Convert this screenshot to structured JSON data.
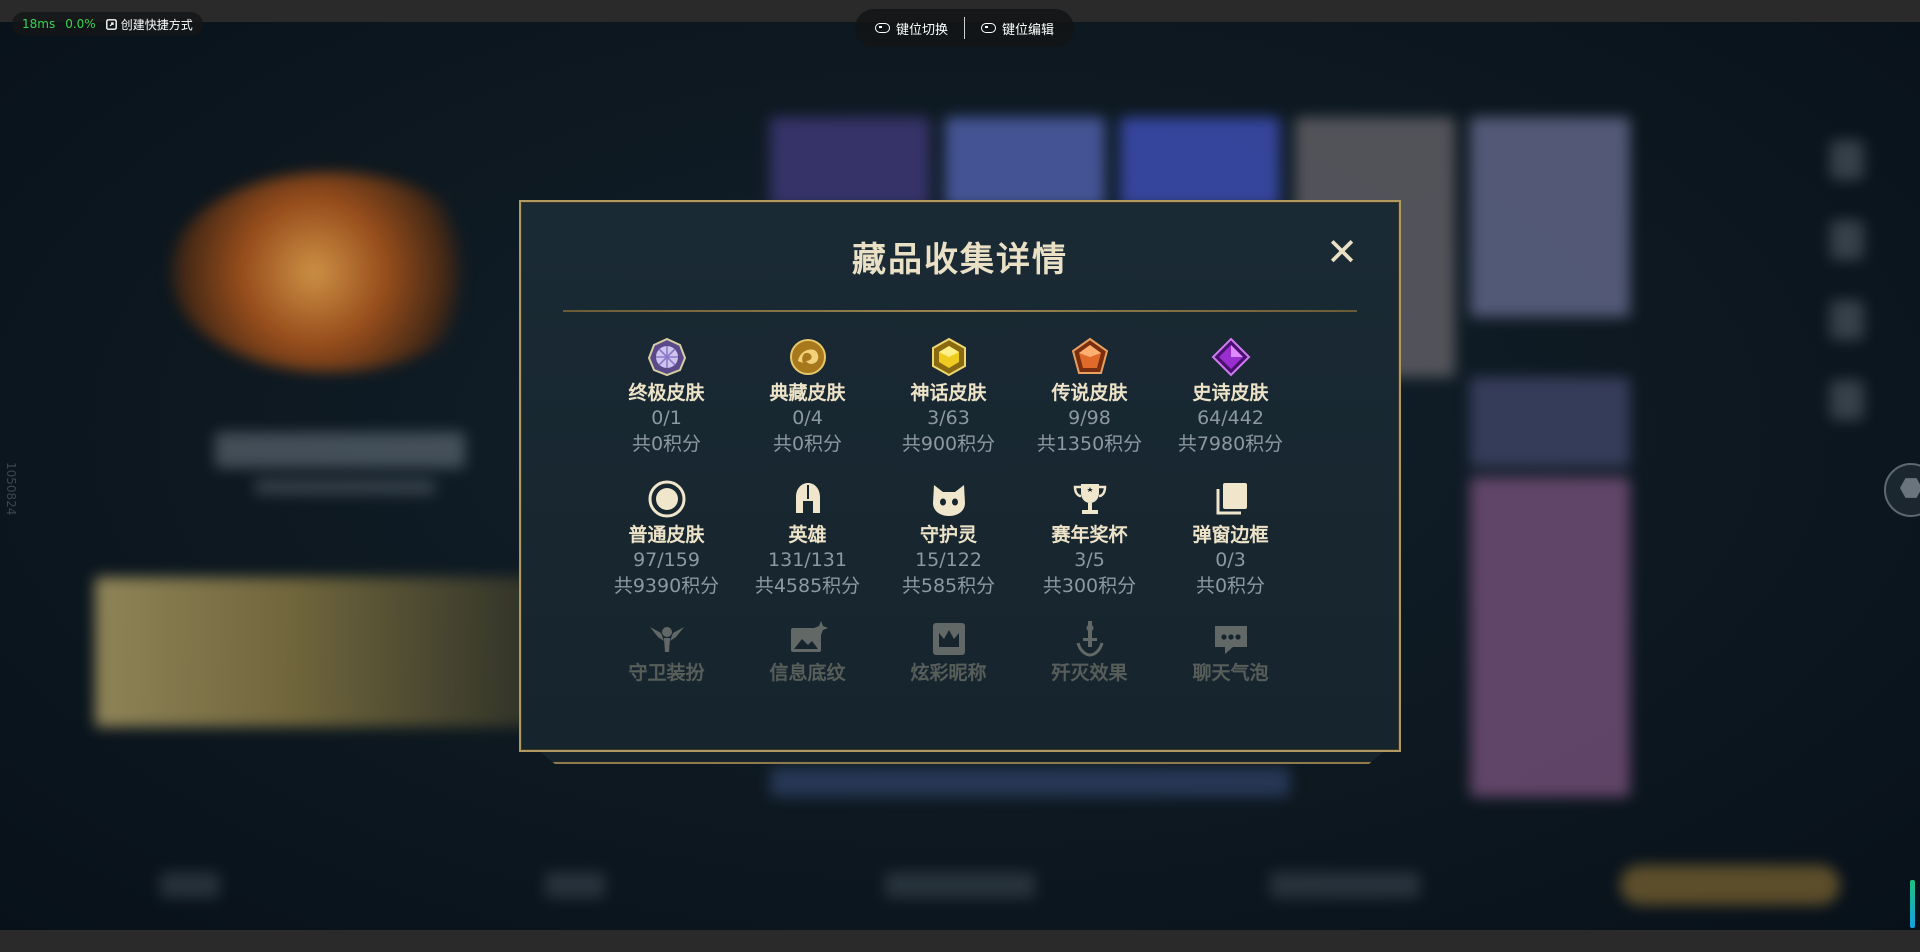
{
  "hud": {
    "latency": "18ms",
    "loss": "0.0%",
    "create_shortcut": "创建快捷方式"
  },
  "keymap": {
    "switch_label": "键位切换",
    "edit_label": "键位编辑"
  },
  "background": {
    "side_vertical_text": "1050824"
  },
  "modal": {
    "title": "藏品收集详情",
    "close_symbol": "✕",
    "items": [
      {
        "name": "终极皮肤",
        "count": "0/1",
        "points": "共0积分",
        "icon": "ultimate-gem-icon"
      },
      {
        "name": "典藏皮肤",
        "count": "0/4",
        "points": "共0积分",
        "icon": "dragon-emblem-icon"
      },
      {
        "name": "神话皮肤",
        "count": "3/63",
        "points": "共900积分",
        "icon": "mythic-gem-icon"
      },
      {
        "name": "传说皮肤",
        "count": "9/98",
        "points": "共1350积分",
        "icon": "legendary-gem-icon"
      },
      {
        "name": "史诗皮肤",
        "count": "64/442",
        "points": "共7980积分",
        "icon": "epic-gem-icon"
      },
      {
        "name": "普通皮肤",
        "count": "97/159",
        "points": "共9390积分",
        "icon": "circle-icon"
      },
      {
        "name": "英雄",
        "count": "131/131",
        "points": "共4585积分",
        "icon": "helmet-icon"
      },
      {
        "name": "守护灵",
        "count": "15/122",
        "points": "共585积分",
        "icon": "cat-face-icon"
      },
      {
        "name": "赛年奖杯",
        "count": "3/5",
        "points": "共300积分",
        "icon": "trophy-icon"
      },
      {
        "name": "弹窗边框",
        "count": "0/3",
        "points": "共0积分",
        "icon": "stacked-cards-icon"
      },
      {
        "name": "守卫装扮",
        "icon": "ward-icon"
      },
      {
        "name": "信息底纹",
        "icon": "image-sparkle-icon"
      },
      {
        "name": "炫彩昵称",
        "icon": "crown-badge-icon"
      },
      {
        "name": "歼灭效果",
        "icon": "sword-icon"
      },
      {
        "name": "聊天气泡",
        "icon": "chat-bubble-icon"
      }
    ]
  },
  "colors": {
    "ultimate": "#cfc6f0",
    "dragon": "#d4a53a",
    "mythic": "#e8c21a",
    "legendary": "#e06a2a",
    "epic": "#9a2fd0",
    "gold_border": "#b09a62",
    "text_light": "#ece3c8",
    "text_dim": "#8c98a2",
    "icon_cream": "#efe6cc"
  }
}
